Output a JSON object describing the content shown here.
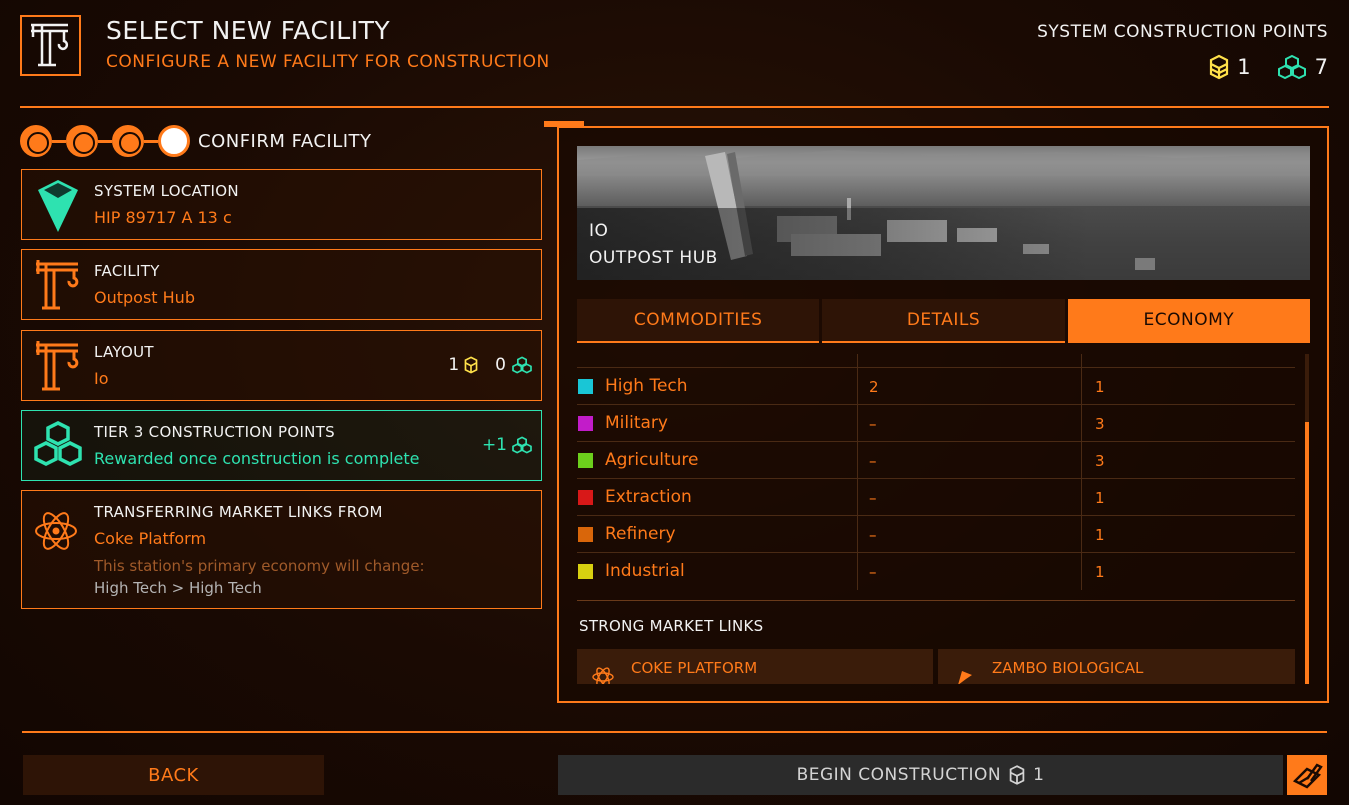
{
  "header": {
    "title": "SELECT NEW FACILITY",
    "subtitle": "CONFIGURE A NEW FACILITY FOR CONSTRUCTION",
    "scp_label": "SYSTEM CONSTRUCTION POINTS",
    "scp_tier2": "1",
    "scp_tier3": "7"
  },
  "stepper": {
    "steps_total": 4,
    "current_step": 4,
    "label": "CONFIRM FACILITY"
  },
  "cards": {
    "location": {
      "title": "SYSTEM LOCATION",
      "value": "HIP 89717 A 13 c"
    },
    "facility": {
      "title": "FACILITY",
      "value": "Outpost Hub"
    },
    "layout": {
      "title": "LAYOUT",
      "value": "Io",
      "cost_tier2": "1",
      "cost_tier3": "0"
    },
    "tier": {
      "title": "TIER 3 CONSTRUCTION POINTS",
      "value": "Rewarded once construction is complete",
      "bonus": "+1"
    },
    "market": {
      "title": "TRANSFERRING MARKET LINKS FROM",
      "value": "Coke Platform",
      "note": "This station's primary economy will change:",
      "change": "High Tech > High Tech"
    }
  },
  "preview": {
    "title": "IO",
    "subtitle": "OUTPOST HUB"
  },
  "tabs": [
    {
      "label": "COMMODITIES",
      "active": false
    },
    {
      "label": "DETAILS",
      "active": false
    },
    {
      "label": "ECONOMY",
      "active": true
    }
  ],
  "economy": {
    "rows": [
      {
        "name": "High Tech",
        "color": "#19c6d6",
        "v1": "2",
        "v2": "1"
      },
      {
        "name": "Military",
        "color": "#c21cc9",
        "v1": "–",
        "v2": "3"
      },
      {
        "name": "Agriculture",
        "color": "#6ccf1c",
        "v1": "–",
        "v2": "3"
      },
      {
        "name": "Extraction",
        "color": "#d81818",
        "v1": "–",
        "v2": "1"
      },
      {
        "name": "Refinery",
        "color": "#d9660a",
        "v1": "–",
        "v2": "1"
      },
      {
        "name": "Industrial",
        "color": "#d8d010",
        "v1": "–",
        "v2": "1"
      }
    ],
    "strong_links_label": "STRONG MARKET LINKS",
    "links": [
      {
        "name": "COKE PLATFORM",
        "icon": "atom-icon"
      },
      {
        "name": "ZAMBO BIOLOGICAL",
        "icon": "flag-icon"
      }
    ]
  },
  "footer": {
    "back_label": "BACK",
    "begin_label": "BEGIN CONSTRUCTION",
    "begin_cost": "1"
  },
  "colors": {
    "accent": "#ff7a1a",
    "teal": "#2ee2b0",
    "yellow": "#ffe14a"
  }
}
